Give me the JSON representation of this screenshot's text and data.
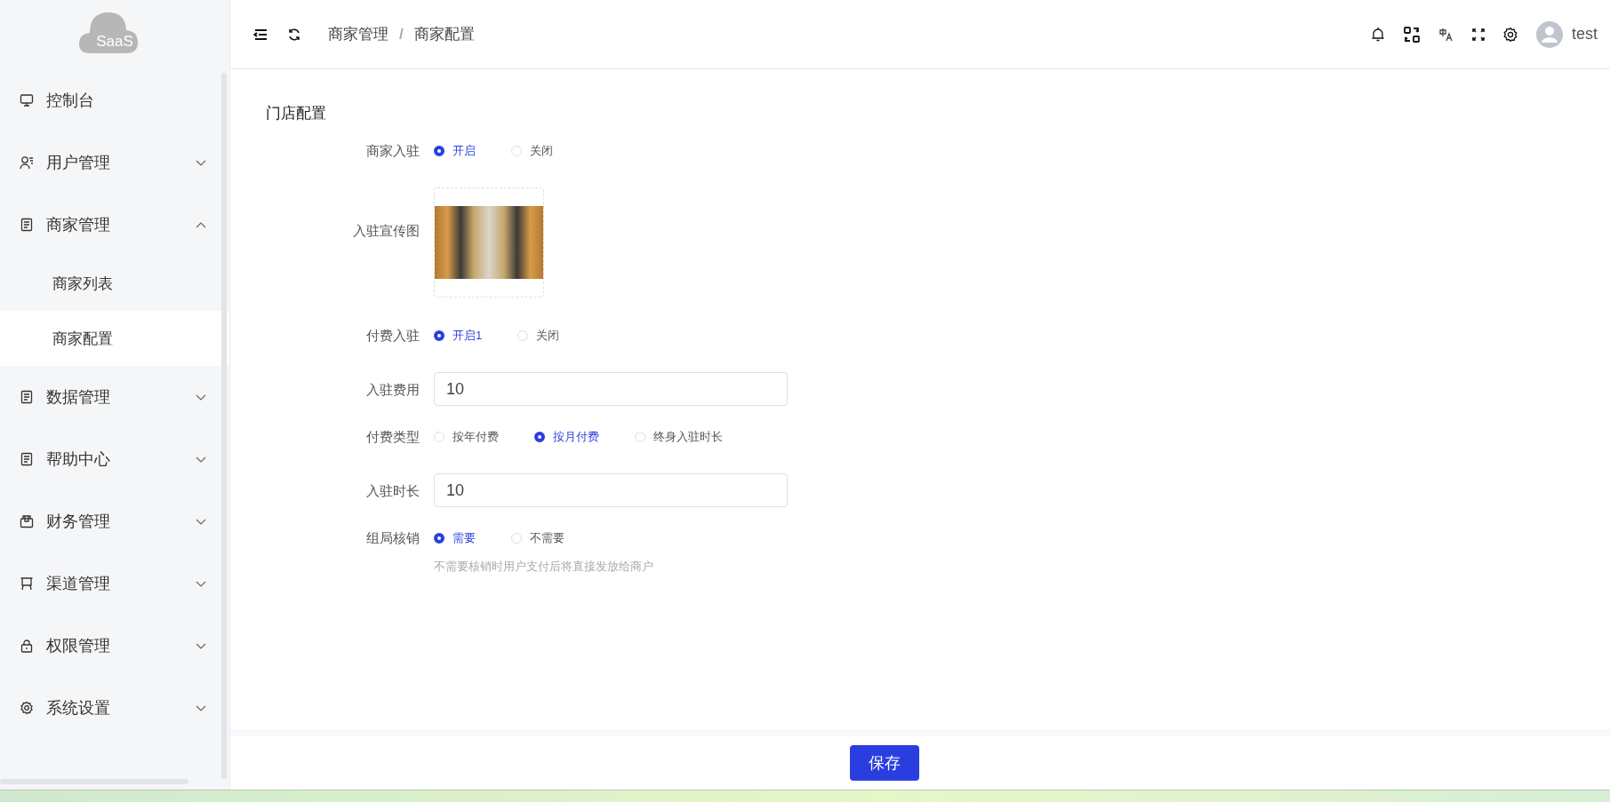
{
  "sidebar": {
    "logo": "SaaS",
    "items": [
      {
        "label": "控制台"
      },
      {
        "label": "用户管理",
        "expanded": false
      },
      {
        "label": "商家管理",
        "expanded": true,
        "children": [
          {
            "label": "商家列表",
            "selected": false
          },
          {
            "label": "商家配置",
            "selected": true
          }
        ]
      },
      {
        "label": "数据管理",
        "expanded": false
      },
      {
        "label": "帮助中心",
        "expanded": false
      },
      {
        "label": "财务管理",
        "expanded": false
      },
      {
        "label": "渠道管理",
        "expanded": false
      },
      {
        "label": "权限管理",
        "expanded": false
      },
      {
        "label": "系统设置",
        "expanded": false
      }
    ]
  },
  "header": {
    "breadcrumb": [
      "商家管理",
      "商家配置"
    ],
    "separator": "/",
    "user": "test"
  },
  "form": {
    "title": "门店配置",
    "fields": [
      {
        "kind": "radio",
        "label": "商家入驻",
        "options": [
          {
            "label": "开启",
            "selected": true
          },
          {
            "label": "关闭",
            "selected": false
          }
        ]
      },
      {
        "kind": "image",
        "label": "入驻宣传图"
      },
      {
        "kind": "radio",
        "label": "付费入驻",
        "options": [
          {
            "label": "开启1",
            "selected": true
          },
          {
            "label": "关闭",
            "selected": false
          }
        ]
      },
      {
        "kind": "input",
        "label": "入驻费用",
        "value": "10"
      },
      {
        "kind": "radio",
        "label": "付费类型",
        "options": [
          {
            "label": "按年付费",
            "selected": false
          },
          {
            "label": "按月付费",
            "selected": true
          },
          {
            "label": "终身入驻时长",
            "selected": false
          }
        ]
      },
      {
        "kind": "input",
        "label": "入驻时长",
        "value": "10"
      },
      {
        "kind": "radio",
        "label": "组局核销",
        "options": [
          {
            "label": "需要",
            "selected": true
          },
          {
            "label": "不需要",
            "selected": false
          }
        ],
        "hint": "不需要核销时用户支付后将直接发放给商户"
      }
    ]
  },
  "footer": {
    "save": "保存"
  }
}
